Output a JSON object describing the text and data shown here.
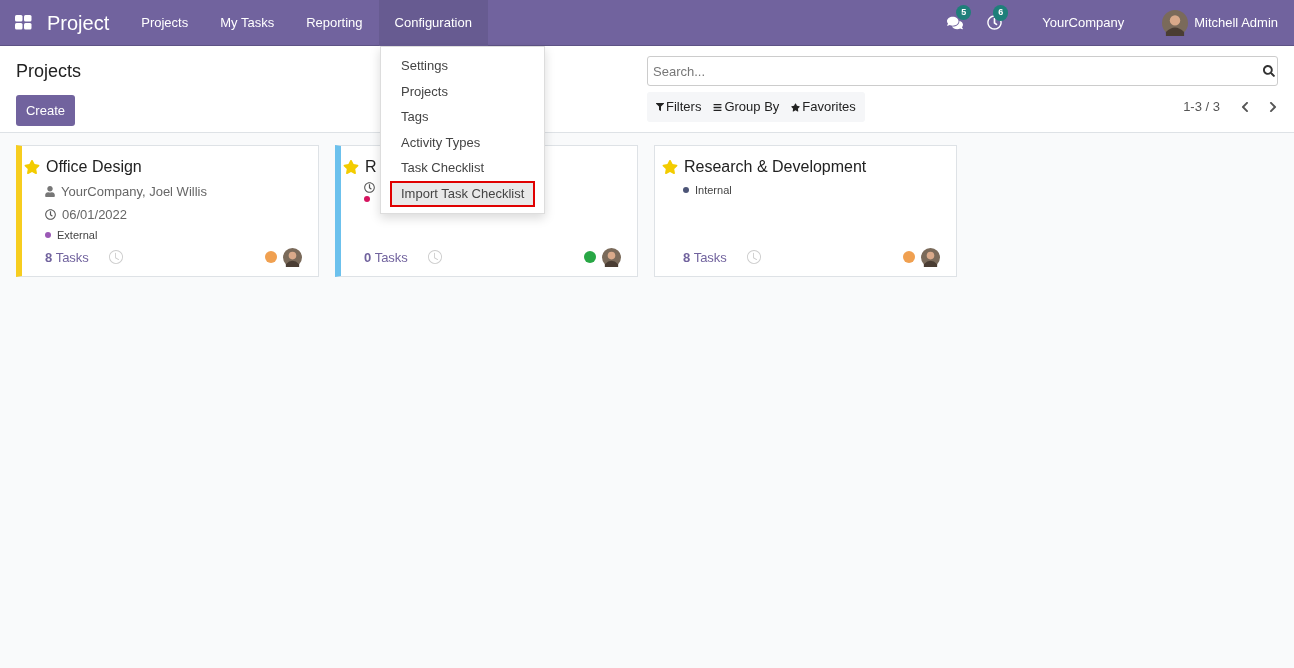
{
  "navbar": {
    "brand": "Project",
    "menu": [
      {
        "label": "Projects",
        "selected": false
      },
      {
        "label": "My Tasks",
        "selected": false
      },
      {
        "label": "Reporting",
        "selected": false
      },
      {
        "label": "Configuration",
        "selected": true
      }
    ],
    "messages_count": "5",
    "activities_count": "6",
    "company": "YourCompany",
    "user": "Mitchell Admin"
  },
  "dropdown": [
    {
      "label": "Settings",
      "selected": false
    },
    {
      "label": "Projects",
      "selected": false
    },
    {
      "label": "Tags",
      "selected": false
    },
    {
      "label": "Activity Types",
      "selected": false
    },
    {
      "label": "Task Checklist",
      "selected": false
    },
    {
      "label": "Import Task Checklist",
      "selected": true
    }
  ],
  "control_panel": {
    "title": "Projects",
    "create": "Create",
    "search": {
      "placeholder": "Search..."
    },
    "filters": "Filters",
    "group_by": "Group By",
    "favorites": "Favorites",
    "pager": "1-3 / 3"
  },
  "cards": [
    {
      "title": "Office Design",
      "favorite": true,
      "color": "#f7cd1f",
      "rows": [
        {
          "kind": "person",
          "text": "YourCompany, Joel Willis"
        },
        {
          "kind": "date",
          "text": "06/01/2022"
        },
        {
          "kind": "tag",
          "text": "External",
          "color": "#9b59b6"
        }
      ],
      "tasks_count": "8",
      "tasks_label": "Tasks",
      "status": {
        "color": "#f0a050"
      }
    },
    {
      "title": "R",
      "favorite": true,
      "color": "#6cc1ed",
      "rows": [
        {
          "kind": "date"
        },
        {
          "kind": "tag",
          "color": "#d6145f"
        }
      ],
      "tasks_count": "0",
      "tasks_label": "Tasks",
      "status": {
        "color": "#28a745"
      }
    },
    {
      "title": "Research & Development",
      "favorite": true,
      "rows": [
        {
          "kind": "tag",
          "text": "Internal",
          "color": "#4c5577"
        }
      ],
      "tasks_count": "8",
      "tasks_label": "Tasks",
      "status": {
        "color": "#f0a050"
      }
    }
  ]
}
